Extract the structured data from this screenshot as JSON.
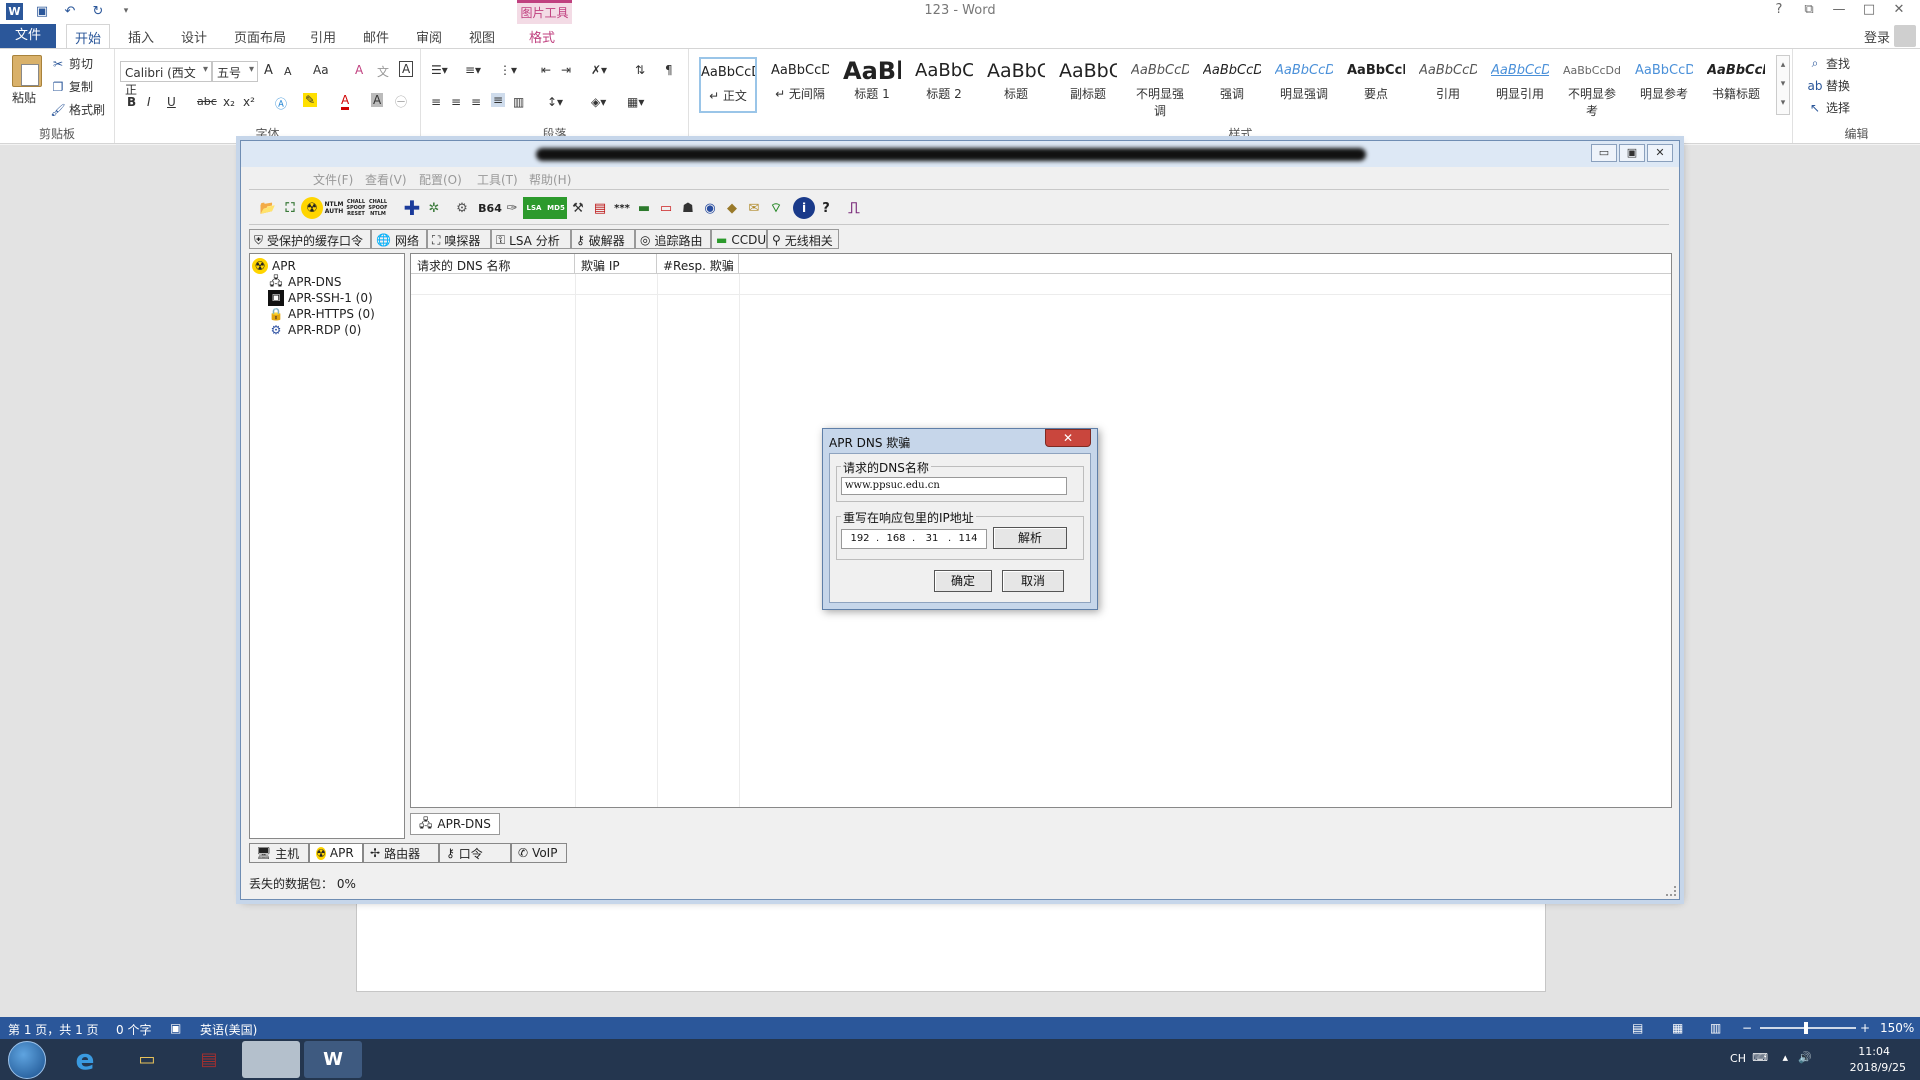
{
  "word": {
    "title": "123 - Word",
    "logo": "W",
    "pic_tools_label": "图片工具",
    "login": "登录",
    "qat": [
      "save-icon",
      "undo-icon",
      "redo-icon"
    ],
    "window_controls": [
      "?",
      "⧉",
      "—",
      "□",
      "✕"
    ],
    "tabs": {
      "file": "文件",
      "home": "开始",
      "insert": "插入",
      "design": "设计",
      "layout": "页面布局",
      "references": "引用",
      "mailings": "邮件",
      "review": "审阅",
      "view": "视图",
      "format": "格式"
    },
    "ribbon": {
      "clipboard": {
        "label": "剪贴板",
        "paste": "粘贴",
        "cut": "剪切",
        "copy": "复制",
        "format_painter": "格式刷"
      },
      "font": {
        "label": "字体",
        "font_name": "Calibri (西文正",
        "font_size": "五号",
        "bold": "B",
        "italic": "I",
        "underline": "U",
        "strike": "abc",
        "sub": "x₂",
        "sup": "x²",
        "grow": "A",
        "shrink": "A",
        "case": "Aa",
        "clear": "A",
        "phonetic": "文",
        "border": "A"
      },
      "paragraph": {
        "label": "段落"
      },
      "styles": {
        "label": "样式",
        "items": [
          {
            "preview": "AaBbCcDd",
            "name": "↵ 正文"
          },
          {
            "preview": "AaBbCcDd",
            "name": "↵ 无间隔"
          },
          {
            "preview": "AaBb",
            "name": "标题 1"
          },
          {
            "preview": "AaBbC",
            "name": "标题 2"
          },
          {
            "preview": "AaBbC",
            "name": "标题"
          },
          {
            "preview": "AaBbC",
            "name": "副标题"
          },
          {
            "preview": "AaBbCcDd",
            "name": "不明显强调"
          },
          {
            "preview": "AaBbCcDd",
            "name": "强调"
          },
          {
            "preview": "AaBbCcDd",
            "name": "明显强调"
          },
          {
            "preview": "AaBbCcDd",
            "name": "要点"
          },
          {
            "preview": "AaBbCcDd",
            "name": "引用"
          },
          {
            "preview": "AaBbCcDd",
            "name": "明显引用"
          },
          {
            "preview": "AaBbCcDdI",
            "name": "不明显参考"
          },
          {
            "preview": "AaBbCcDd",
            "name": "明显参考"
          },
          {
            "preview": "AaBbCcDd",
            "name": "书籍标题"
          }
        ]
      },
      "editing": {
        "label": "编辑",
        "find": "查找",
        "replace": "替换",
        "select": "选择"
      }
    },
    "status": {
      "page": "第 1 页，共 1 页",
      "words": "0 个字",
      "lang": "英语(美国)",
      "zoom": "150%"
    }
  },
  "cain": {
    "menu": {
      "file": "文件(F)",
      "view": "查看(V)",
      "config": "配置(O)",
      "tools": "工具(T)",
      "help": "帮助(H)"
    },
    "toolbar": [
      "folder-icon",
      "network-icon",
      "radiation-icon",
      "ntlm-auth-icon",
      "chall-spoof-reset-icon",
      "chall-spoof-ntlm-icon",
      "add-icon",
      "certificate-icon",
      "hash-icon",
      "base64-icon",
      "key-icon",
      "lsa-icon",
      "hash-calc-icon",
      "tool-icon",
      "box-icon",
      "password-icon",
      "monitor-icon",
      "device-icon",
      "user-icon",
      "globe-icon",
      "disk-icon",
      "credential-icon",
      "wifi-icon",
      "info-icon",
      "help-icon",
      "exit-icon"
    ],
    "toolbar_labels": {
      "ntlm_auth": "NTLM AUTH",
      "chall_reset": "CHALL SPOOF RESET",
      "chall_ntlm": "CHALL SPOOF NTLM",
      "b64": "B64",
      "pwd": "***"
    },
    "tabs": [
      "受保护的缓存口令",
      "网络",
      "嗅探器",
      "LSA 分析",
      "破解器",
      "追踪路由",
      "CCDU",
      "无线相关"
    ],
    "tree": [
      {
        "label": "APR"
      },
      {
        "label": "APR-DNS"
      },
      {
        "label": "APR-SSH-1 (0)"
      },
      {
        "label": "APR-HTTPS (0)"
      },
      {
        "label": "APR-RDP (0)"
      }
    ],
    "columns": [
      "请求的 DNS 名称",
      "欺骗 IP",
      "#Resp. 欺骗"
    ],
    "subtab": "APR-DNS",
    "bottom_tabs": [
      "主机",
      "APR",
      "路由器",
      "口令",
      "VoIP"
    ],
    "status": "丢失的数据包：  0%"
  },
  "dialog": {
    "title": "APR DNS 欺骗",
    "close": "✕",
    "dns_label": "请求的DNS名称",
    "dns_value": "www.ppsuc.edu.cn",
    "ip_label": "重写在响应包里的IP地址",
    "ip": [
      "192",
      "168",
      "31",
      "114"
    ],
    "resolve": "解析",
    "ok": "确定",
    "cancel": "取消"
  },
  "taskbar": {
    "apps": [
      "internet-explorer-icon",
      "file-explorer-icon",
      "winrar-icon",
      "blank-window-icon",
      "word-icon"
    ],
    "tray": {
      "lang": "CH",
      "time": "11:04",
      "date": "2018/9/25"
    }
  }
}
